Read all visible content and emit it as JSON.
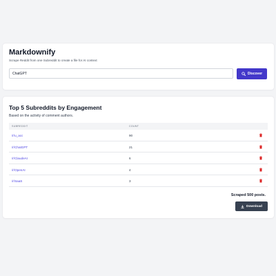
{
  "app": {
    "title": "Markdownify",
    "subtitle": "Scrape Reddit from one Subreddit to create a file for AI context"
  },
  "search": {
    "value": "ChatGPT",
    "button_label": "Discover",
    "button_icon": "search-icon"
  },
  "results": {
    "title": "Top 5 Subreddits by Engagement",
    "subtitle": "Based on the activity of comment authors.",
    "columns": [
      "SUBREDDIT",
      "COUNT"
    ],
    "rows": [
      {
        "subreddit": "/r/u_acc",
        "count": "90"
      },
      {
        "subreddit": "/r/ChatGPT",
        "count": "21"
      },
      {
        "subreddit": "/r/ClaudeAI",
        "count": "6"
      },
      {
        "subreddit": "/r/OpenAI",
        "count": "4"
      },
      {
        "subreddit": "/r/SaaS",
        "count": "3"
      }
    ],
    "row_action_icon": "trash-icon",
    "scraped_text": "Scraped 500 posts.",
    "download_label": "Download",
    "download_icon": "download-icon"
  },
  "colors": {
    "background": "#f3f4f6",
    "primary": "#4338ca",
    "link": "#4f46e5",
    "delete": "#dc2626",
    "download_button": "#374151"
  }
}
